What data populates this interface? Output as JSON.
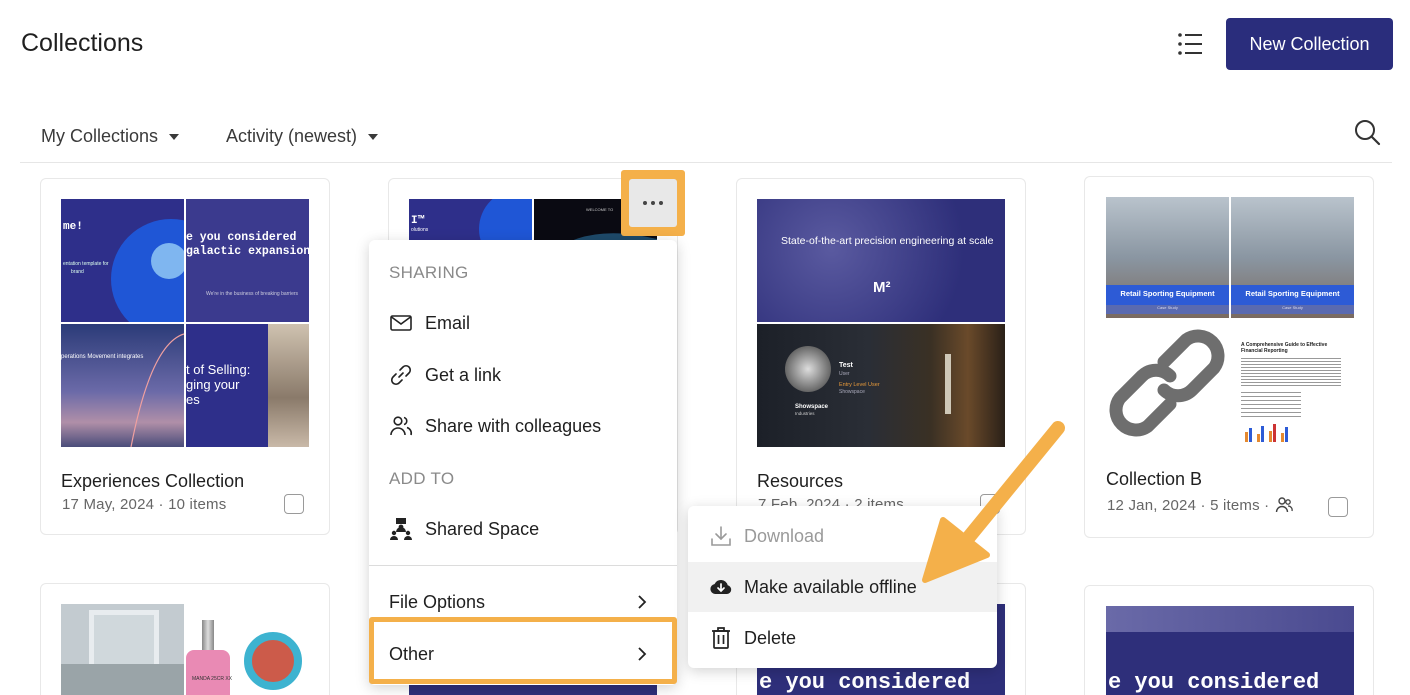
{
  "header": {
    "title": "Collections",
    "new_collection_label": "New Collection"
  },
  "filters": {
    "scope": "My Collections",
    "sort": "Activity (newest)"
  },
  "cards": [
    {
      "title": "Experiences Collection",
      "meta": "17 May, 2024 · 10 items",
      "thumb_texts": [
        "me!",
        "e you considered ",
        "galactic expansion",
        "entation template for",
        "brand",
        "We're in the business of breaking barriers",
        "perations Movement integrates",
        "t of Selling:",
        "ging your",
        "es"
      ]
    },
    {
      "title": "",
      "meta": "",
      "thumb_texts": [
        "I™",
        "olutions",
        "WELCOME TO"
      ]
    },
    {
      "title": "Resources",
      "meta": "7 Feb, 2024 · 2 items",
      "thumb_texts": [
        "State-of-the-art precision engineering at scale",
        "M²",
        "Test",
        "User",
        "Entry Level User",
        "Showspace",
        "Showspace",
        "Industries"
      ]
    },
    {
      "title": "Collection B",
      "meta": "12 Jan, 2024 · 5 items ·",
      "thumb_texts": [
        "Retail Sporting Equipment",
        "Case Study",
        "Retail Sporting Equipment",
        "Case Study",
        "A Comprehensive Guide to Effective Financial Reporting"
      ]
    }
  ],
  "bottom_cards": [
    {
      "thumb_text": "MANDA 25CR XX"
    },
    {
      "thumb_text": "e you considered "
    },
    {
      "thumb_text": "e you considered "
    }
  ],
  "context_menu": {
    "sharing_header": "SHARING",
    "email": "Email",
    "get_link": "Get a link",
    "share_colleagues": "Share with colleagues",
    "add_to_header": "ADD TO",
    "shared_space": "Shared Space",
    "file_options": "File Options",
    "other": "Other"
  },
  "submenu": {
    "download": "Download",
    "offline": "Make available offline",
    "delete": "Delete"
  },
  "colors": {
    "primary": "#2a2d7c",
    "highlight": "#f4b04a",
    "slide_navy": "#2e2f8a"
  }
}
